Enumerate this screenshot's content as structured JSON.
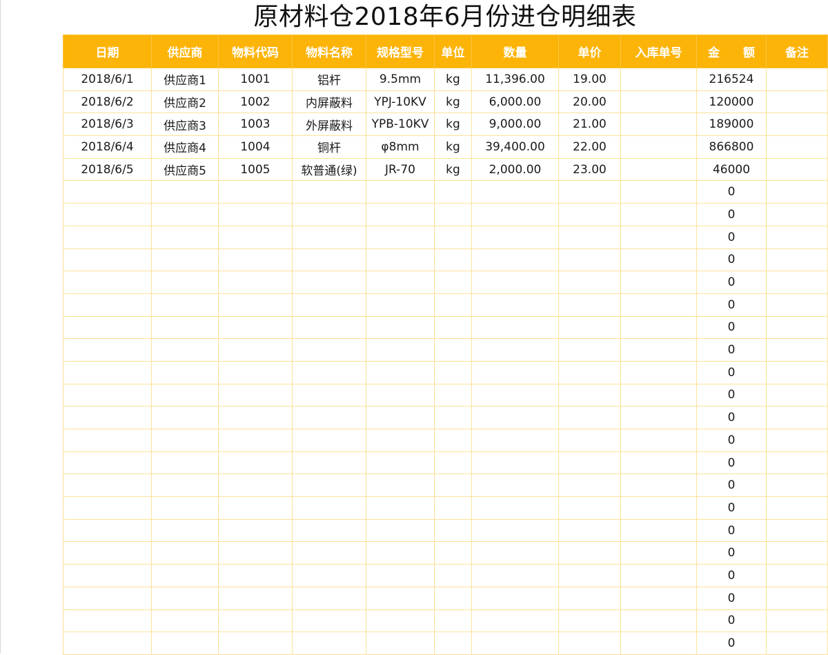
{
  "title": "原材料仓2018年6月份进仓明细表",
  "columns": [
    "日期",
    "供应商",
    "物料代码",
    "物料名称",
    "规格型号",
    "单位",
    "数量",
    "单价",
    "入库单号",
    "金　　额",
    "备注"
  ],
  "rows": [
    [
      "2018/6/1",
      "供应商1",
      "1001",
      "铝杆",
      "9.5mm",
      "kg",
      "11,396.00",
      "19.00",
      "",
      "216524",
      ""
    ],
    [
      "2018/6/2",
      "供应商2",
      "1002",
      "内屏蔽料",
      "YPJ-10KV",
      "kg",
      "6,000.00",
      "20.00",
      "",
      "120000",
      ""
    ],
    [
      "2018/6/3",
      "供应商3",
      "1003",
      "外屏蔽料",
      "YPB-10KV",
      "kg",
      "9,000.00",
      "21.00",
      "",
      "189000",
      ""
    ],
    [
      "2018/6/4",
      "供应商4",
      "1004",
      "铜杆",
      "φ8mm",
      "kg",
      "39,400.00",
      "22.00",
      "",
      "866800",
      ""
    ],
    [
      "2018/6/5",
      "供应商5",
      "1005",
      "软普通(绿)",
      "JR-70",
      "kg",
      "2,000.00",
      "23.00",
      "",
      "46000",
      ""
    ],
    [
      "",
      "",
      "",
      "",
      "",
      "",
      "",
      "",
      "",
      "0",
      ""
    ],
    [
      "",
      "",
      "",
      "",
      "",
      "",
      "",
      "",
      "",
      "0",
      ""
    ],
    [
      "",
      "",
      "",
      "",
      "",
      "",
      "",
      "",
      "",
      "0",
      ""
    ],
    [
      "",
      "",
      "",
      "",
      "",
      "",
      "",
      "",
      "",
      "0",
      ""
    ],
    [
      "",
      "",
      "",
      "",
      "",
      "",
      "",
      "",
      "",
      "0",
      ""
    ],
    [
      "",
      "",
      "",
      "",
      "",
      "",
      "",
      "",
      "",
      "0",
      ""
    ],
    [
      "",
      "",
      "",
      "",
      "",
      "",
      "",
      "",
      "",
      "0",
      ""
    ],
    [
      "",
      "",
      "",
      "",
      "",
      "",
      "",
      "",
      "",
      "0",
      ""
    ],
    [
      "",
      "",
      "",
      "",
      "",
      "",
      "",
      "",
      "",
      "0",
      ""
    ],
    [
      "",
      "",
      "",
      "",
      "",
      "",
      "",
      "",
      "",
      "0",
      ""
    ],
    [
      "",
      "",
      "",
      "",
      "",
      "",
      "",
      "",
      "",
      "0",
      ""
    ],
    [
      "",
      "",
      "",
      "",
      "",
      "",
      "",
      "",
      "",
      "0",
      ""
    ],
    [
      "",
      "",
      "",
      "",
      "",
      "",
      "",
      "",
      "",
      "0",
      ""
    ],
    [
      "",
      "",
      "",
      "",
      "",
      "",
      "",
      "",
      "",
      "0",
      ""
    ],
    [
      "",
      "",
      "",
      "",
      "",
      "",
      "",
      "",
      "",
      "0",
      ""
    ],
    [
      "",
      "",
      "",
      "",
      "",
      "",
      "",
      "",
      "",
      "0",
      ""
    ],
    [
      "",
      "",
      "",
      "",
      "",
      "",
      "",
      "",
      "",
      "0",
      ""
    ],
    [
      "",
      "",
      "",
      "",
      "",
      "",
      "",
      "",
      "",
      "0",
      ""
    ],
    [
      "",
      "",
      "",
      "",
      "",
      "",
      "",
      "",
      "",
      "0",
      ""
    ],
    [
      "",
      "",
      "",
      "",
      "",
      "",
      "",
      "",
      "",
      "0",
      ""
    ],
    [
      "",
      "",
      "",
      "",
      "",
      "",
      "",
      "",
      "",
      "0",
      ""
    ]
  ],
  "colors": {
    "header_background": "#fdb409",
    "header_text": "#ffffff",
    "grid_line": "#fce296"
  }
}
